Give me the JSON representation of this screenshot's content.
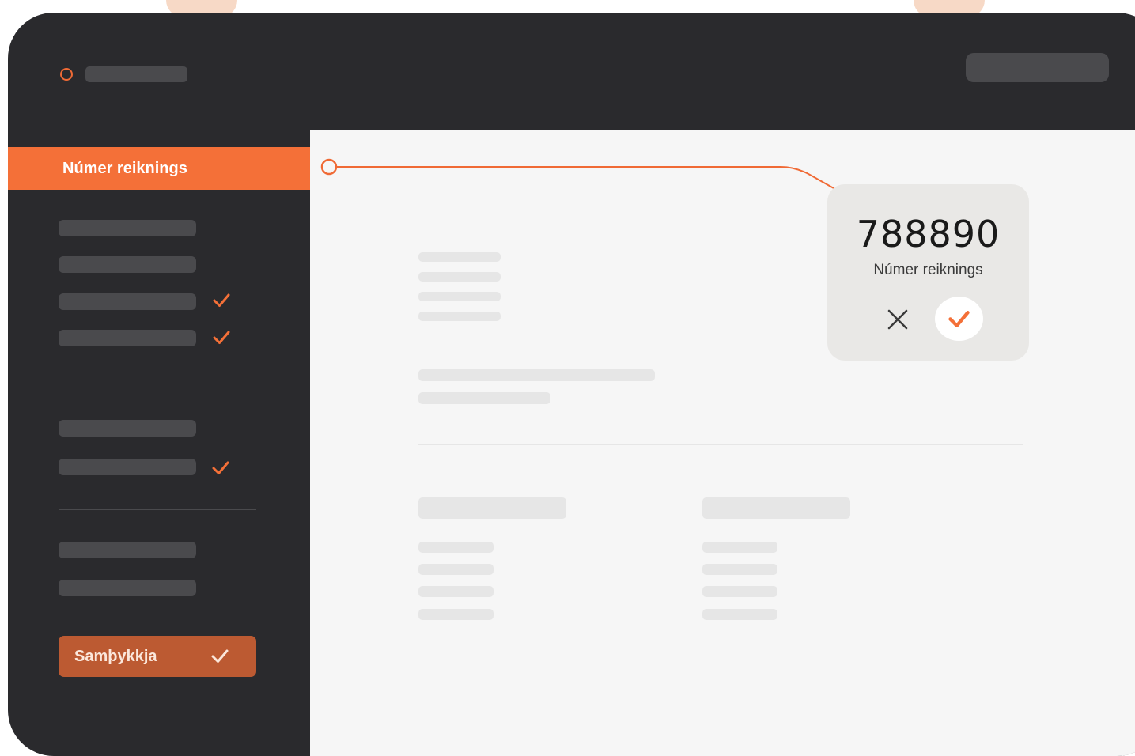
{
  "sidebar": {
    "active_item_label": "Númer reiknings",
    "approve_button_label": "Samþykkja"
  },
  "popup": {
    "value": "788890",
    "label": "Númer reiknings",
    "reject_icon": "close-icon",
    "accept_icon": "check-icon"
  },
  "colors": {
    "accent": "#f47038",
    "dark_background": "#2a2a2d",
    "content_background": "#f6f6f6"
  }
}
